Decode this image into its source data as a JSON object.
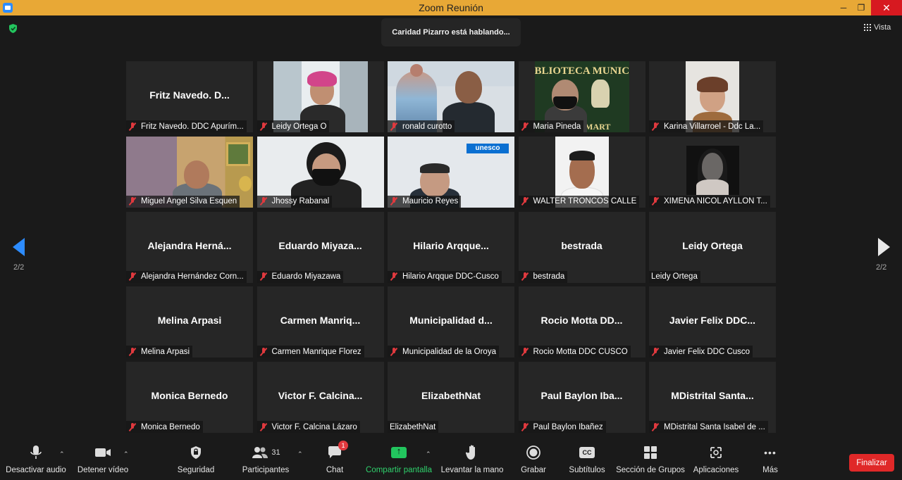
{
  "window": {
    "title": "Zoom Reunión"
  },
  "top": {
    "speaking": "Caridad Pizarro está hablando...",
    "view_label": "Vista"
  },
  "pager": {
    "left": "2/2",
    "right": "2/2"
  },
  "tiles": [
    {
      "big": "Fritz  Navedo.  D...",
      "label": "Fritz Navedo. DDC Apurím...",
      "muted": true,
      "video": false
    },
    {
      "big": "",
      "label": "Leidy Ortega O",
      "muted": true,
      "video": true
    },
    {
      "big": "",
      "label": "ronald curotto",
      "muted": true,
      "video": true
    },
    {
      "big": "",
      "label": "Maria Pineda",
      "muted": true,
      "video": true
    },
    {
      "big": "",
      "label": "Karina Villarroel  -  Ddc La...",
      "muted": true,
      "video": true
    },
    {
      "big": "",
      "label": "Miguel Angel Silva Esquen",
      "muted": true,
      "video": true
    },
    {
      "big": "",
      "label": "Jhossy Rabanal",
      "muted": true,
      "video": true
    },
    {
      "big": "",
      "label": "Mauricio Reyes",
      "muted": true,
      "video": true
    },
    {
      "big": "",
      "label": "WALTER TRONCOS CALLE",
      "muted": true,
      "video": true
    },
    {
      "big": "",
      "label": "XIMENA NICOL AYLLON T...",
      "muted": true,
      "video": true
    },
    {
      "big": "Alejandra  Herná...",
      "label": "Alejandra Hernández Corn...",
      "muted": true,
      "video": false
    },
    {
      "big": "Eduardo  Miyaza...",
      "label": "Eduardo Miyazawa",
      "muted": true,
      "video": false
    },
    {
      "big": "Hilario  Arqque...",
      "label": "Hilario Arqque DDC-Cusco",
      "muted": true,
      "video": false
    },
    {
      "big": "bestrada",
      "label": "bestrada",
      "muted": true,
      "video": false
    },
    {
      "big": "Leidy Ortega",
      "label": "Leidy Ortega",
      "muted": false,
      "video": false
    },
    {
      "big": "Melina Arpasi",
      "label": "Melina Arpasi",
      "muted": true,
      "video": false
    },
    {
      "big": "Carmen  Manriq...",
      "label": "Carmen Manrique Florez",
      "muted": true,
      "video": false
    },
    {
      "big": "Municipalidad  d...",
      "label": "Municipalidad de la Oroya",
      "muted": true,
      "video": false
    },
    {
      "big": "Rocio  Motta  DD...",
      "label": "Rocio Motta DDC CUSCO",
      "muted": true,
      "video": false
    },
    {
      "big": "Javier  Felix  DDC...",
      "label": "Javier Felix DDC Cusco",
      "muted": true,
      "video": false
    },
    {
      "big": "Monica Bernedo",
      "label": "Monica Bernedo",
      "muted": true,
      "video": false
    },
    {
      "big": "Victor  F.  Calcina...",
      "label": "Victor F. Calcina Lázaro",
      "muted": true,
      "video": false
    },
    {
      "big": "ElizabethNat",
      "label": "ElizabethNat",
      "muted": false,
      "video": false
    },
    {
      "big": "Paul  Baylon  Iba...",
      "label": "Paul Baylon Ibañez",
      "muted": true,
      "video": false
    },
    {
      "big": "MDistrital  Santa...",
      "label": "MDistrital Santa Isabel de ...",
      "muted": true,
      "video": false
    }
  ],
  "scene_text": {
    "unesco": "unesco",
    "library": "BLIOTECA MUNICIPA",
    "library2": "N MART"
  },
  "toolbar": {
    "mute": "Desactivar audio",
    "video": "Detener vídeo",
    "security": "Seguridad",
    "participants": "Participantes",
    "participants_count": "31",
    "chat": "Chat",
    "chat_badge": "1",
    "share": "Compartir pantalla",
    "raise": "Levantar la mano",
    "record": "Grabar",
    "subtitles": "Subtítulos",
    "subtitles_icon": "CC",
    "breakout": "Sección de Grupos",
    "apps": "Aplicaciones",
    "more": "Más",
    "more_icon": "•••",
    "end": "Finalizar"
  }
}
